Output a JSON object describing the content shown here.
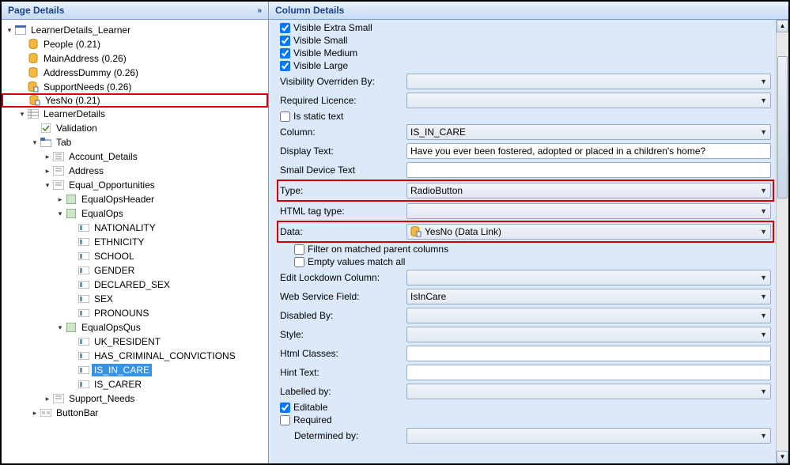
{
  "panels": {
    "left_title": "Page Details",
    "right_title": "Column Details"
  },
  "tree": {
    "root": "LearnerDetails_Learner",
    "people": "People (0.21)",
    "mainaddress": "MainAddress (0.26)",
    "addressdummy": "AddressDummy (0.26)",
    "supportneeds": "SupportNeeds (0.26)",
    "yesno": "YesNo (0.21)",
    "learnerdetails": "LearnerDetails",
    "validation": "Validation",
    "tab": "Tab",
    "account_details": "Account_Details",
    "address": "Address",
    "equal_opportunities": "Equal_Opportunities",
    "equalopsheader": "EqualOpsHeader",
    "equalops": "EqualOps",
    "nationality": "NATIONALITY",
    "ethnicity": "ETHNICITY",
    "school": "SCHOOL",
    "gender": "GENDER",
    "declared_sex": "DECLARED_SEX",
    "sex": "SEX",
    "pronouns": "PRONOUNS",
    "equalopsqus": "EqualOpsQus",
    "uk_resident": "UK_RESIDENT",
    "has_criminal": "HAS_CRIMINAL_CONVICTIONS",
    "is_in_care": "IS_IN_CARE",
    "is_carer": "IS_CARER",
    "support_needs2": "Support_Needs",
    "buttonbar": "ButtonBar"
  },
  "details": {
    "visible_extra_small": "Visible Extra Small",
    "visible_small": "Visible Small",
    "visible_medium": "Visible Medium",
    "visible_large": "Visible Large",
    "visibility_overriden_by": "Visibility Overriden By:",
    "required_licence": "Required Licence:",
    "is_static_text": "Is static text",
    "column": "Column:",
    "column_val": "IS_IN_CARE",
    "display_text": "Display Text:",
    "display_text_val": "Have you ever been fostered, adopted or placed in a children's home?",
    "small_device_text": "Small Device Text",
    "type": "Type:",
    "type_val": "RadioButton",
    "html_tag_type": "HTML tag type:",
    "data": "Data:",
    "data_val": "YesNo (Data Link)",
    "filter_matched": "Filter on matched parent columns",
    "empty_values": "Empty values match all",
    "edit_lockdown": "Edit Lockdown Column:",
    "web_service_field": "Web Service Field:",
    "web_service_val": "IsInCare",
    "disabled_by": "Disabled By:",
    "style": "Style:",
    "html_classes": "Html Classes:",
    "hint_text": "Hint Text:",
    "labelled_by": "Labelled by:",
    "editable": "Editable",
    "required": "Required",
    "determined_by": "Determined by:"
  }
}
